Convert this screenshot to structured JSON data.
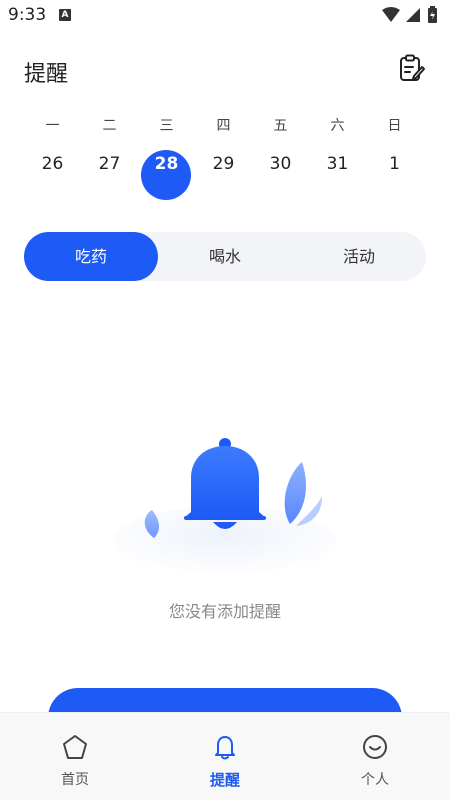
{
  "status_bar": {
    "time": "9:33",
    "notification_glyph": "A"
  },
  "header": {
    "title": "提醒",
    "action_icon": "clipboard-edit-icon"
  },
  "week": {
    "weekdays": [
      "一",
      "二",
      "三",
      "四",
      "五",
      "六",
      "日"
    ],
    "dates": [
      "26",
      "27",
      "28",
      "29",
      "30",
      "31",
      "1"
    ],
    "selected_index": 2
  },
  "tabs": [
    {
      "label": "吃药",
      "active": true
    },
    {
      "label": "喝水",
      "active": false
    },
    {
      "label": "活动",
      "active": false
    }
  ],
  "empty_state": {
    "message": "您没有添加提醒",
    "icon": "bell-icon"
  },
  "bottom_nav": [
    {
      "label": "首页",
      "icon": "home-icon",
      "active": false
    },
    {
      "label": "提醒",
      "icon": "bell-icon",
      "active": true
    },
    {
      "label": "个人",
      "icon": "smile-icon",
      "active": false
    }
  ],
  "colors": {
    "accent": "#1e5af5",
    "segment_bg": "#f3f4f8",
    "nav_bg": "#f8f8f8"
  }
}
